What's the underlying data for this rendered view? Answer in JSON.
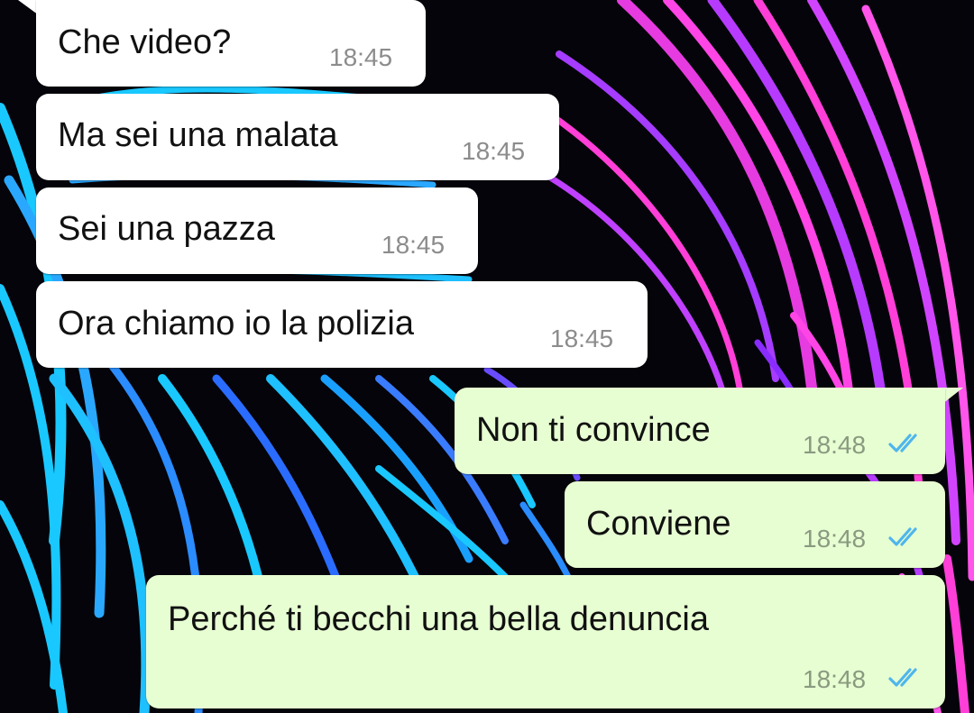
{
  "chat": {
    "colors": {
      "incoming_bubble": "#ffffff",
      "outgoing_bubble": "#e7fed2",
      "read_ticks": "#4fb6ec",
      "time_text": "#8c8c8c"
    },
    "messages": [
      {
        "direction": "incoming",
        "text": "Che video?",
        "time": "18:45"
      },
      {
        "direction": "incoming",
        "text": "Ma sei una malata",
        "time": "18:45"
      },
      {
        "direction": "incoming",
        "text": "Sei una pazza",
        "time": "18:45"
      },
      {
        "direction": "incoming",
        "text": "Ora chiamo io la polizia",
        "time": "18:45"
      },
      {
        "direction": "outgoing",
        "text": "Non ti convince",
        "time": "18:48",
        "status": "read-double-check-icon"
      },
      {
        "direction": "outgoing",
        "text": "Conviene",
        "time": "18:48",
        "status": "read-double-check-icon"
      },
      {
        "direction": "outgoing",
        "text": "Perché ti becchi una bella denuncia",
        "time": "18:48",
        "status": "read-double-check-icon"
      }
    ]
  }
}
